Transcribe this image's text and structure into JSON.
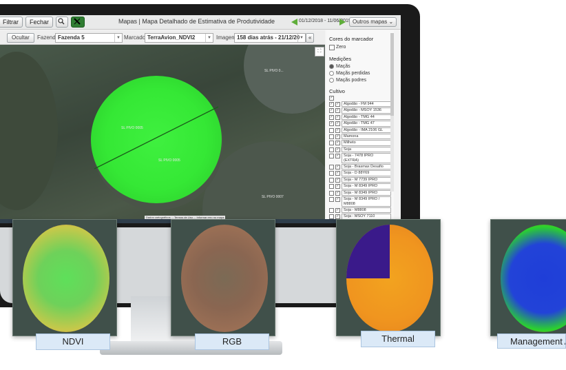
{
  "toolbar": {
    "filter_label": "Filtrar",
    "close_label": "Fechar",
    "title": "Mapas | Mapa Detalhado de Estimativa de Produtividade",
    "date_range": "01/12/2018 - 11/06/2019",
    "other_maps_label": "Outros mapas"
  },
  "filterbar": {
    "hide_label": "Ocultar",
    "farm_label": "Fazenda",
    "farm_value": "Fazenda 5",
    "marker_label": "Marcador",
    "marker_value": "TerraAvion_NDVI2",
    "image_label": "Imagem",
    "image_value": "158 dias atrás - 21/12/20"
  },
  "map": {
    "labels": [
      "SL PIVO 0...",
      "SL PIVO 0005",
      "SL PIVO 0005",
      "SL PIVO 0007"
    ],
    "footer": "Dados cartográficos ... Termos de Uso ... Informar erro no mapa"
  },
  "panel": {
    "marker_colors_title": "Cores do marcador",
    "marker_color_option": "Zero",
    "measurements_title": "Medições",
    "measurements": [
      "Maçãs",
      "Maçãs perdidas",
      "Maçãs podres"
    ],
    "crop_title": "Cultivo",
    "crops": [
      "Algodão - FM 944",
      "Algodão - MSOY 1536",
      "Algodão - TMG 44",
      "Algodão - TMG 47",
      "Algodão - IMA 2106 GL",
      "Mamona",
      "Milheto",
      "Soja",
      "Soja - 7478 IPRO (EXTRA)",
      "Soja - Brasmax Desafio",
      "Soja - D 88Y69",
      "Soja - M 7739 IPRO",
      "Soja - M 8349 IPRO",
      "Soja - M 8349 IPRO",
      "Soja - M 8349 IPRO / M8808",
      "Soja - M8808",
      "Soja - MSOY 7110",
      "Soja - MSOY 7739",
      "Soja - MSOY 8349",
      "Soja - TMG 2182"
    ]
  },
  "tiles": [
    {
      "caption": "NDVI"
    },
    {
      "caption": "RGB"
    },
    {
      "caption": "Thermal"
    },
    {
      "caption": "Management A"
    }
  ],
  "colors": {
    "ndvi_green": "#2ee62e",
    "toolbar_bg": "#e9eaea",
    "caption_bg": "#dbe9f7",
    "nav_arrow": "#5fae3a"
  }
}
